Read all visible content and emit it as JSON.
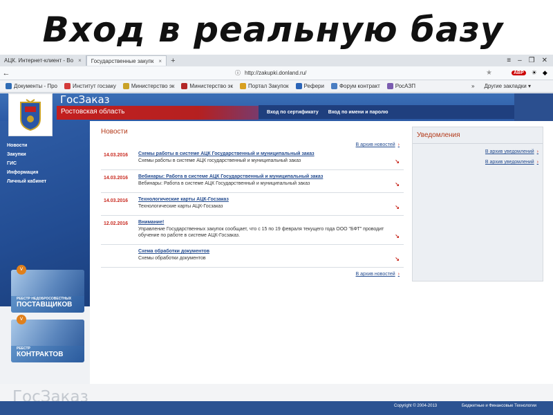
{
  "slide": {
    "title": "Вход в реальную базу"
  },
  "browser": {
    "tabs": [
      {
        "label": "АЦК. Интернет-клиент - Во"
      },
      {
        "label": "Государственные закупк"
      }
    ],
    "new_tab": "+",
    "window_controls": [
      "≡",
      "–",
      "❐",
      "✕"
    ],
    "url": "http://zakupki.donland.ru/",
    "back": "←",
    "abp": "ABP",
    "bookmarks": [
      {
        "label": "Документы - Про",
        "color": "#2f6cb5"
      },
      {
        "label": "Институт госзаку",
        "color": "#d33a3a"
      },
      {
        "label": "Министерство эк",
        "color": "#c9a227"
      },
      {
        "label": "Министерство эк",
        "color": "#b32828"
      },
      {
        "label": "Портал Закупок",
        "color": "#d8a020"
      },
      {
        "label": "Рефери",
        "color": "#2a64b7"
      },
      {
        "label": "Форум контракт",
        "color": "#4a7ec2"
      },
      {
        "label": "РосАЗП",
        "color": "#7a5cb0"
      }
    ],
    "more_bookmarks": "»",
    "other_bookmarks": "Другие закладки ▾"
  },
  "site": {
    "brand": "ГосЗаказ",
    "region": "Ростовская область",
    "login_cert": "Вход по сертификату",
    "login_password": "Вход по имени и паролю",
    "menu": [
      "Новости",
      "Закупки",
      "ГИС",
      "Информация",
      "Личный кабинет"
    ],
    "banner1": {
      "small": "РЕЕСТР НЕДОБРОСОВЕСТНЫХ",
      "big": "ПОСТАВЩИКОВ"
    },
    "banner2": {
      "small": "РЕЕСТР",
      "big": "КОНТРАКТОВ"
    },
    "chevron": "˅"
  },
  "news": {
    "title": "Новости",
    "archive": "В архив новостей",
    "arrow": "›",
    "go": "↘",
    "items": [
      {
        "date": "14.03.2016",
        "title": "Схемы работы в системе АЦК Государственный и муниципальный заказ",
        "text": "Схемы работы в системе АЦК государственный и муниципальный заказ"
      },
      {
        "date": "14.03.2016",
        "title": "Вебинары: Работа в системе АЦК Государственный и муниципальный заказ",
        "text": "Вебинары: Работа в системе АЦК Государственный и муниципальный заказ"
      },
      {
        "date": "14.03.2016",
        "title": "Технологические карты АЦК-Госзаказ",
        "text": "Технологические карты АЦК-Госзаказ"
      },
      {
        "date": "12.02.2016",
        "title": "Внимание!",
        "text": "Управление Государственных закупок сообщает, что с 15 по 19 февраля текущего года ООО \"БФТ\" проводит обучение по работе в системе АЦК-Госзаказ."
      },
      {
        "date": "",
        "title": "Схема обработки документов",
        "text": "Схемы обработки документов"
      }
    ]
  },
  "notifications": {
    "title": "Уведомления",
    "archive": "В архив уведомлений"
  },
  "footer": {
    "logo": "ГосЗаказ",
    "copyright": "Copyright © 2004-2013",
    "company": "Бюджетные и Финансовые Технологии"
  }
}
